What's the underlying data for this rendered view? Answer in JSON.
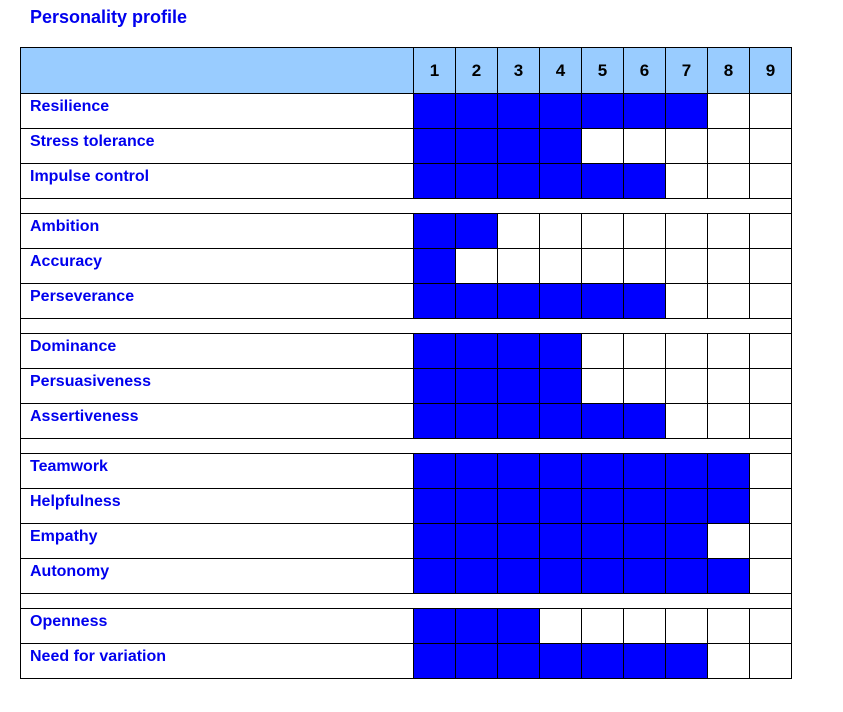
{
  "title": "Personality profile",
  "chart_data": {
    "type": "table",
    "title": "Personality profile",
    "scale": [
      1,
      2,
      3,
      4,
      5,
      6,
      7,
      8,
      9
    ],
    "max": 9,
    "groups": [
      {
        "items": [
          {
            "label": "Resilience",
            "value": 7
          },
          {
            "label": "Stress tolerance",
            "value": 4
          },
          {
            "label": "Impulse control",
            "value": 6
          }
        ]
      },
      {
        "items": [
          {
            "label": "Ambition",
            "value": 2
          },
          {
            "label": "Accuracy",
            "value": 1
          },
          {
            "label": "Perseverance",
            "value": 6
          }
        ]
      },
      {
        "items": [
          {
            "label": "Dominance",
            "value": 4
          },
          {
            "label": "Persuasiveness",
            "value": 4
          },
          {
            "label": "Assertiveness",
            "value": 6
          }
        ]
      },
      {
        "items": [
          {
            "label": "Teamwork",
            "value": 8
          },
          {
            "label": "Helpfulness",
            "value": 8
          },
          {
            "label": "Empathy",
            "value": 7
          },
          {
            "label": "Autonomy",
            "value": 8
          }
        ]
      },
      {
        "items": [
          {
            "label": "Openness",
            "value": 3
          },
          {
            "label": "Need for variation",
            "value": 7
          }
        ]
      }
    ]
  },
  "colors": {
    "filled": "#0000ff",
    "header": "#99ccff",
    "label_text": "#0000ee"
  }
}
